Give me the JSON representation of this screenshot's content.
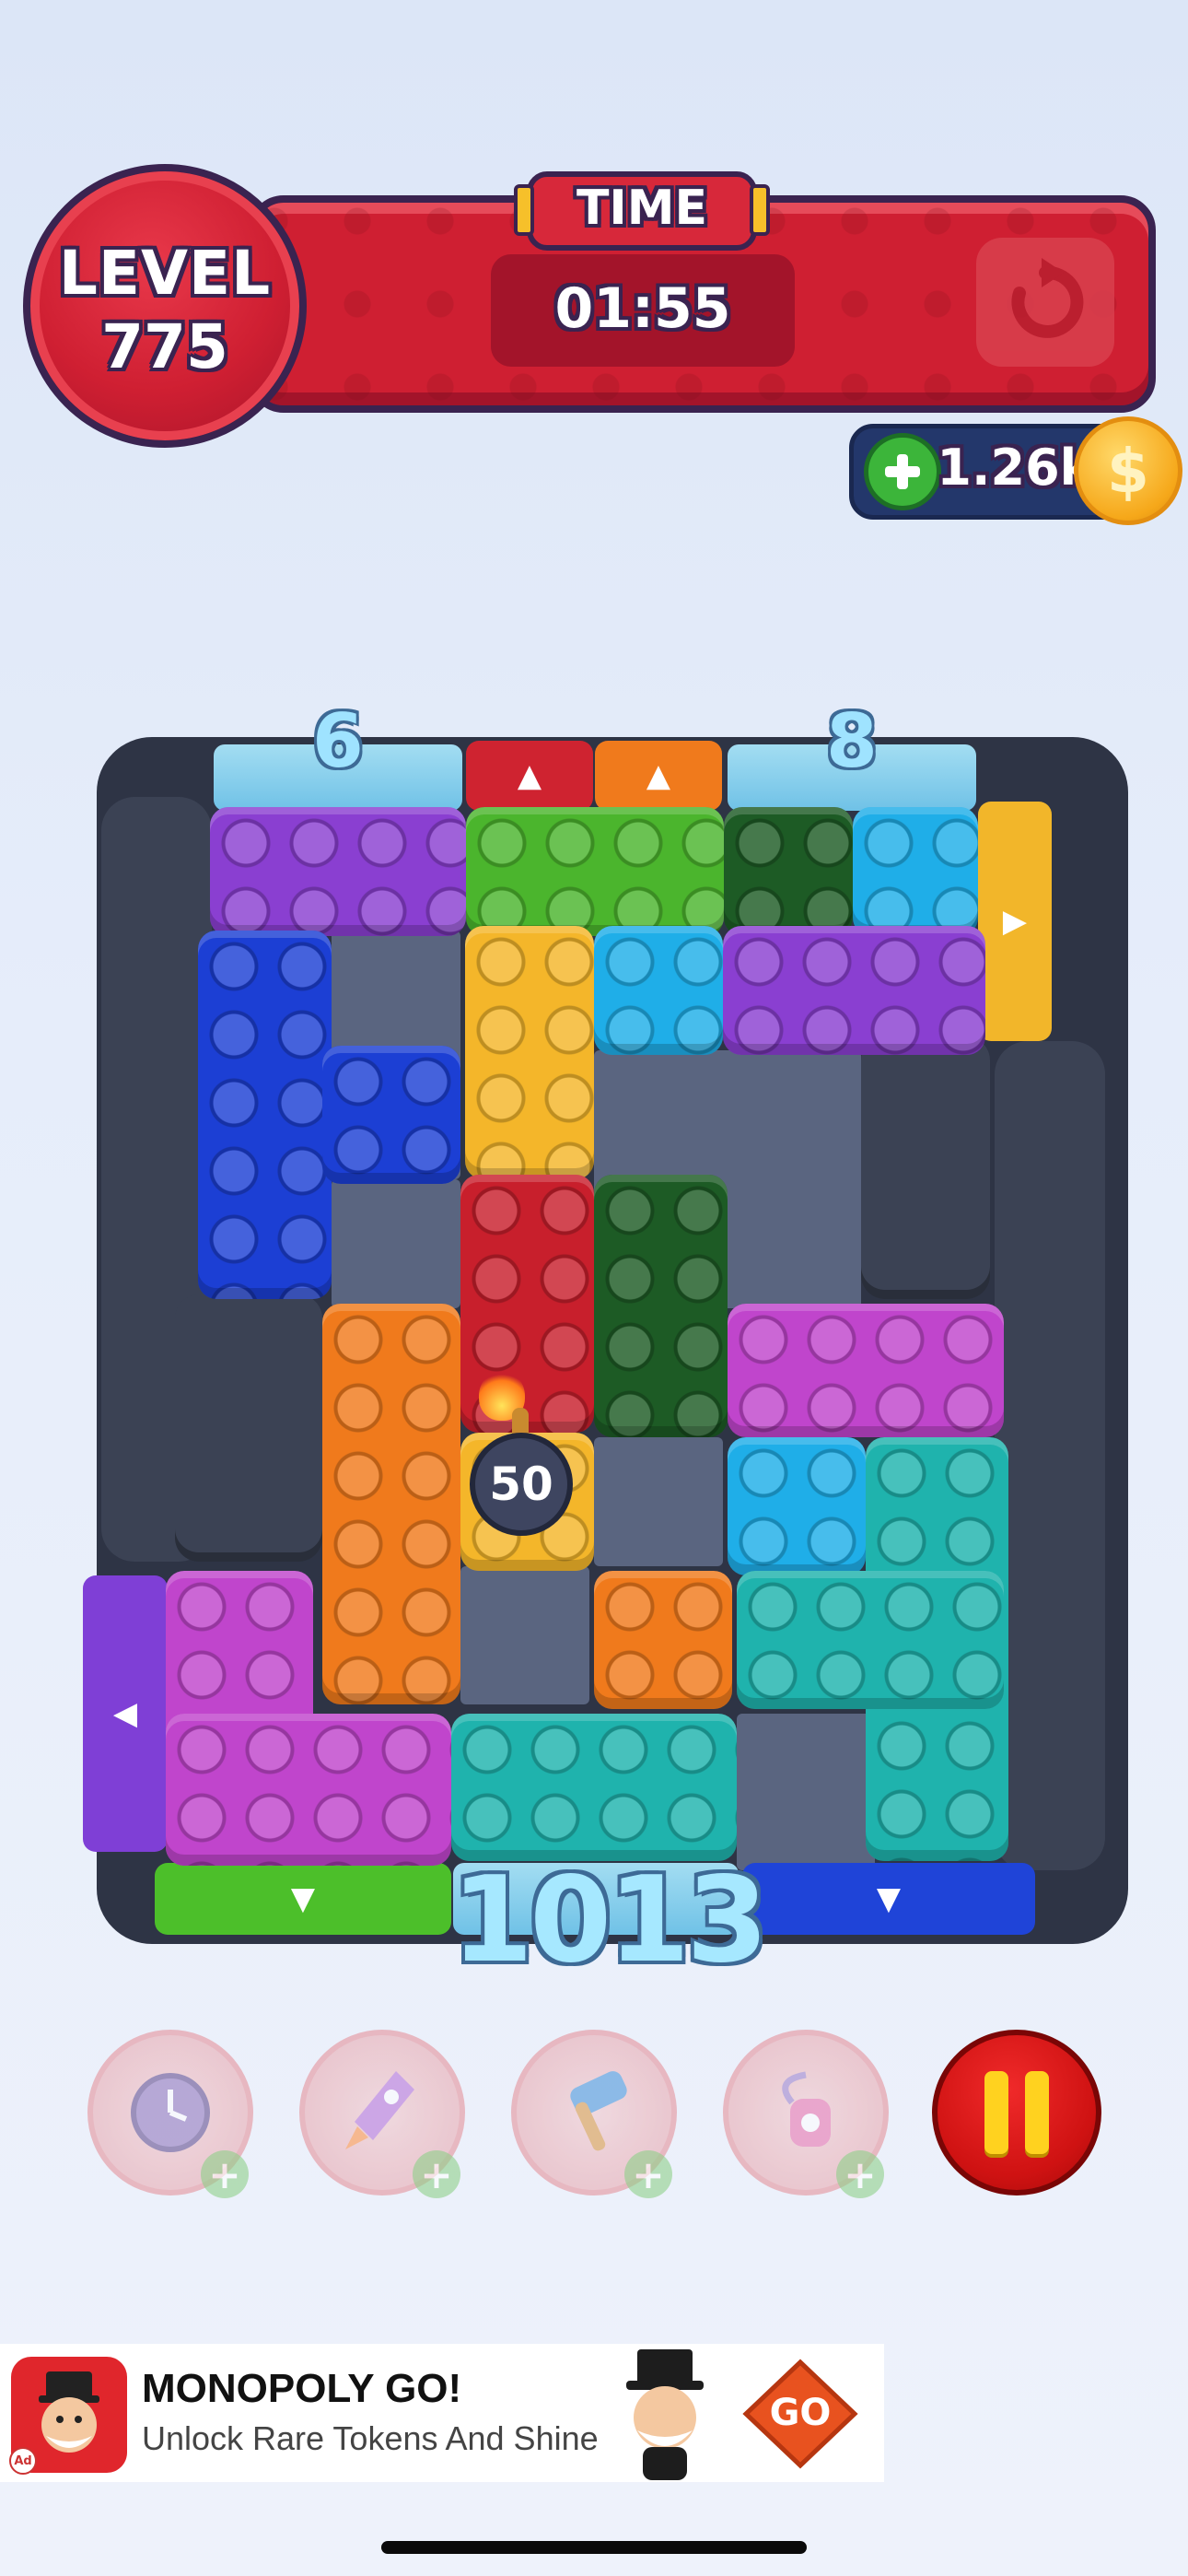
{
  "header": {
    "level_label": "LEVEL",
    "level_number": "775",
    "time_label": "TIME",
    "time_value": "01:55",
    "restart_icon": "restart-icon"
  },
  "currency": {
    "add_icon": "plus-icon",
    "coins": "1.26k",
    "coin_icon": "coin-icon",
    "coin_symbol": "$"
  },
  "board": {
    "top_counters": [
      "6",
      "8"
    ],
    "bottom_counter": "1013",
    "bomb_value": "50",
    "gate_arrow_up": "▲",
    "gate_arrow_down": "▼",
    "gate_arrow_left": "◀",
    "gate_arrow_right": "▶"
  },
  "powerups": [
    {
      "name": "freeze-clock-powerup",
      "icon": "clock-icon"
    },
    {
      "name": "rocket-powerup",
      "icon": "rocket-icon"
    },
    {
      "name": "hammer-powerup",
      "icon": "hammer-icon"
    },
    {
      "name": "vacuum-powerup",
      "icon": "vacuum-icon"
    }
  ],
  "pause_icon": "pause-icon",
  "ad": {
    "title": "MONOPOLY GO!",
    "subtitle": "Unlock Rare Tokens And Shine",
    "cta": "GO",
    "tag": "Ad"
  },
  "colors": {
    "header_red": "#cf1f32",
    "outline_purple": "#3a2350",
    "board_dark": "#2e3445",
    "cell_gray": "#5a6580",
    "pause_red": "#cf1212",
    "coin_gold": "#f6a81a"
  }
}
